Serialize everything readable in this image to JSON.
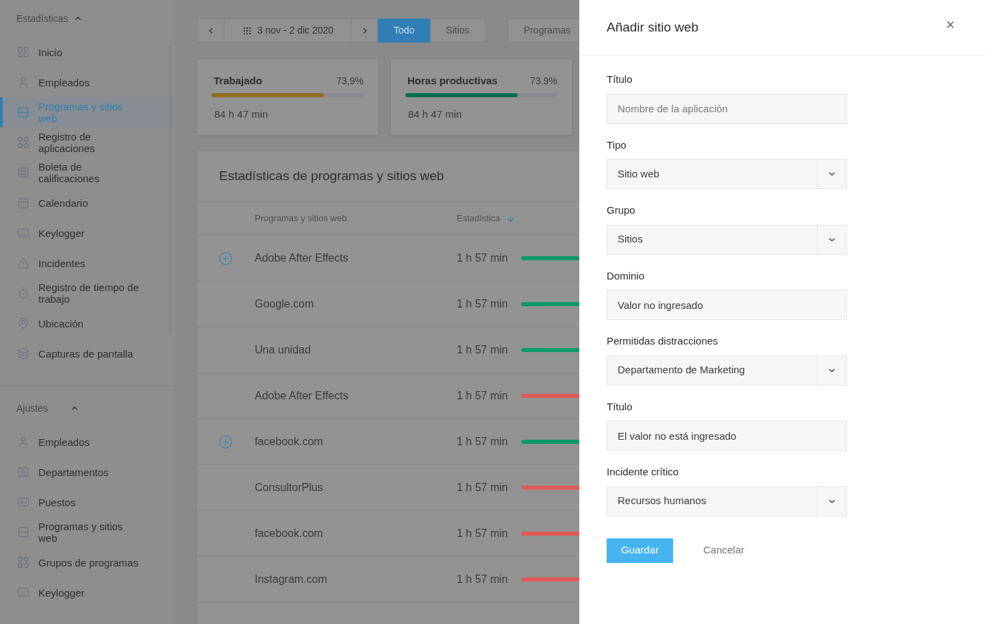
{
  "sidebar": {
    "sections": [
      {
        "title": "Estadísticas",
        "expanded": true,
        "items": [
          {
            "label": "Inicio",
            "selected": false
          },
          {
            "label": "Empleados",
            "selected": false
          },
          {
            "label": "Programas y sitios web",
            "selected": true
          },
          {
            "label": "Registro de aplicaciones",
            "selected": false
          },
          {
            "label": "Boleta de calificaciones",
            "selected": false
          },
          {
            "label": "Calendario",
            "selected": false
          },
          {
            "label": "Keylogger",
            "selected": false
          },
          {
            "label": "Incidentes",
            "selected": false
          },
          {
            "label": "Registro de tiempo de trabajo",
            "selected": false
          },
          {
            "label": "Ubicación",
            "selected": false
          },
          {
            "label": "Capturas de pantalla",
            "selected": false
          }
        ]
      },
      {
        "title": "Ajustes",
        "expanded": true,
        "items": [
          {
            "label": "Empleados",
            "selected": false
          },
          {
            "label": "Departamentos",
            "selected": false
          },
          {
            "label": "Puestos",
            "selected": false
          },
          {
            "label": "Programas y sitios web",
            "selected": false
          },
          {
            "label": "Grupos de programas",
            "selected": false
          },
          {
            "label": "Keylogger",
            "selected": false
          }
        ]
      }
    ]
  },
  "toolbar": {
    "date_range": "3 nov - 2 dic 2020",
    "filters": [
      {
        "label": "Todo",
        "selected": true
      },
      {
        "label": "Sitios",
        "selected": false
      }
    ],
    "programs_button": "Programas"
  },
  "stat_cards": [
    {
      "title": "Trabajado",
      "percent": "73,9%",
      "level": 0.74,
      "color": "#8f6d1f",
      "value": "84 h 47 min"
    },
    {
      "title": "Horas productivas",
      "percent": "73.9%",
      "level": 0.74,
      "color": "#04704f",
      "value": "84 h 47 min"
    }
  ],
  "table": {
    "title": "Estadísticas de programas y sitios web",
    "columns": [
      "Programas y sitios web",
      "Estadística"
    ],
    "rows": [
      {
        "name": "Adobe After Effects",
        "time": "1 h 57 min",
        "expandable": true,
        "color": "#0b9b6c"
      },
      {
        "name": "Google.com",
        "time": "1 h 57 min",
        "expandable": false,
        "color": "#0b9b6c"
      },
      {
        "name": "Una unidad",
        "time": "1 h 57 min",
        "expandable": false,
        "color": "#0b9b6c"
      },
      {
        "name": "Adobe After Effects",
        "time": "1 h 57 min",
        "expandable": false,
        "color": "#e05a5a"
      },
      {
        "name": "facebook.com",
        "time": "1 h 57 min",
        "expandable": true,
        "color": "#0b9b6c"
      },
      {
        "name": "ConsultorPlus",
        "time": "1 h 57 min",
        "expandable": false,
        "color": "#e05a5a"
      },
      {
        "name": "facebook.com",
        "time": "1 h 57 min",
        "expandable": false,
        "color": "#e05a5a"
      },
      {
        "name": "Instagram.com",
        "time": "1 h 57 min",
        "expandable": false,
        "color": "#e05a5a"
      }
    ]
  },
  "dialog": {
    "title": "Añadir sitio web",
    "fields": [
      {
        "label": "Título",
        "kind": "input",
        "placeholder": "Nombre de la aplicación"
      },
      {
        "label": "Tipo",
        "kind": "select",
        "value": "Sitio web"
      },
      {
        "label": "Grupo",
        "kind": "select",
        "value": "Sitios"
      },
      {
        "label": "Dominio",
        "kind": "input",
        "value": "Valor no ingresado"
      },
      {
        "label": "Permitidas distracciones",
        "kind": "select",
        "value": "Departamento de Marketing"
      },
      {
        "label": "Título",
        "kind": "input",
        "value": "El valor no está ingresado"
      },
      {
        "label": "Incidente crítico",
        "kind": "select",
        "value": "Recursos humanos"
      }
    ],
    "save_button": "Guardar",
    "cancel_button": "Cancelar"
  }
}
